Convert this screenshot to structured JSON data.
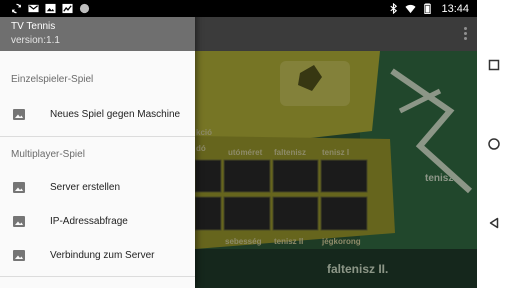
{
  "status_bar": {
    "time": "13:44",
    "left_icons": [
      "sync-icon",
      "gmail-icon",
      "image-icon",
      "chart-icon",
      "dot-icon"
    ],
    "right_icons": [
      "bluetooth-icon",
      "wifi-icon",
      "battery-icon"
    ]
  },
  "drawer": {
    "title": "TV Tennis",
    "version": "version:1.1",
    "sections": [
      {
        "label": "Einzelspieler-Spiel",
        "items": [
          {
            "label": "Neues Spiel gegen Maschine",
            "icon": "image-icon"
          }
        ]
      },
      {
        "label": "Multiplayer-Spiel",
        "items": [
          {
            "label": "Server erstellen",
            "icon": "image-icon"
          },
          {
            "label": "IP-Adressabfrage",
            "icon": "image-icon"
          },
          {
            "label": "Verbindung zum Server",
            "icon": "image-icon"
          }
        ]
      }
    ]
  },
  "background": {
    "console_labels": [
      "kció",
      "dó",
      "utóméret",
      "faltenisz",
      "tenisz I",
      "sebesség",
      "tenisz II",
      "jégkorong",
      "tenisz",
      "faltenisz II."
    ]
  },
  "nav_bar": {
    "buttons": [
      "recents-button",
      "home-button",
      "back-button"
    ]
  },
  "colors": {
    "drawer_header": "#6f6f6f",
    "drawer_bg": "#fafafa",
    "console_yellow": "#b8b83a",
    "appbar": "#5b5b5b"
  }
}
